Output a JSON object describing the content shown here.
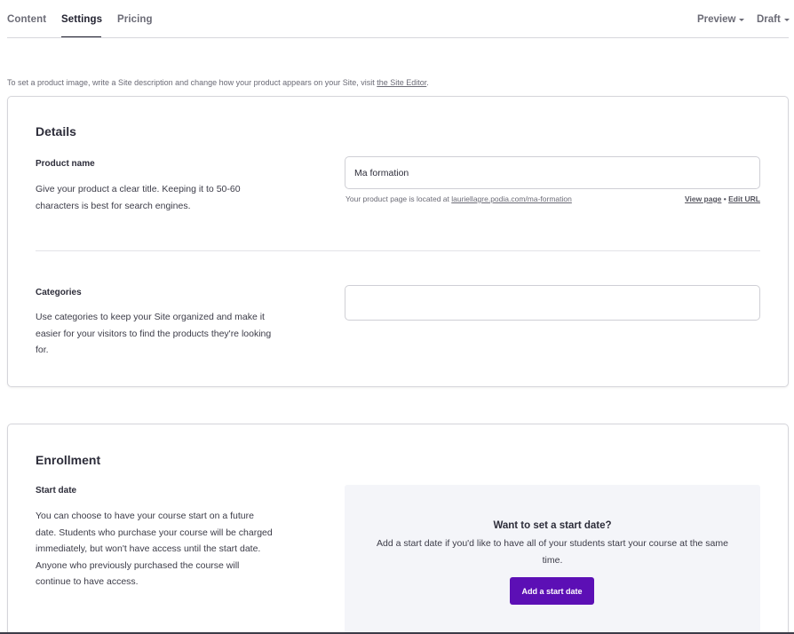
{
  "nav": {
    "tabs": [
      {
        "label": "Content"
      },
      {
        "label": "Settings",
        "active": true
      },
      {
        "label": "Pricing"
      }
    ],
    "preview_label": "Preview",
    "status_label": "Draft"
  },
  "intro": {
    "text": "To set a product image, write a Site description and change how your product appears on your Site, visit ",
    "link": "the Site Editor",
    "suffix": "."
  },
  "details": {
    "title": "Details",
    "product_name": {
      "label": "Product name",
      "description": "Give your product a clear title. Keeping it to 50-60 characters is best for search engines.",
      "value": "Ma formation",
      "url_prefix": "Your product page is located at ",
      "url": "lauriellagre.podia.com/ma-formation",
      "view_page": "View page",
      "separator": " • ",
      "edit_url": "Edit URL"
    },
    "categories": {
      "label": "Categories",
      "description": "Use categories to keep your Site organized and make it easier for your visitors to find the products they're looking for.",
      "value": ""
    }
  },
  "enrollment": {
    "title": "Enrollment",
    "start_date": {
      "label": "Start date",
      "description": "You can choose to have your course start on a future date. Students who purchase your course will be charged immediately, but won't have access until the start date. Anyone who previously purchased the course will continue to have access.",
      "panel_heading": "Want to set a start date?",
      "panel_text": "Add a start date if you'd like to have all of your students start your course at the same time.",
      "button_label": "Add a start date"
    }
  },
  "colors": {
    "accent": "#5c0fb5",
    "panel_bg": "#f4f5f9",
    "border": "#d5d5da"
  }
}
